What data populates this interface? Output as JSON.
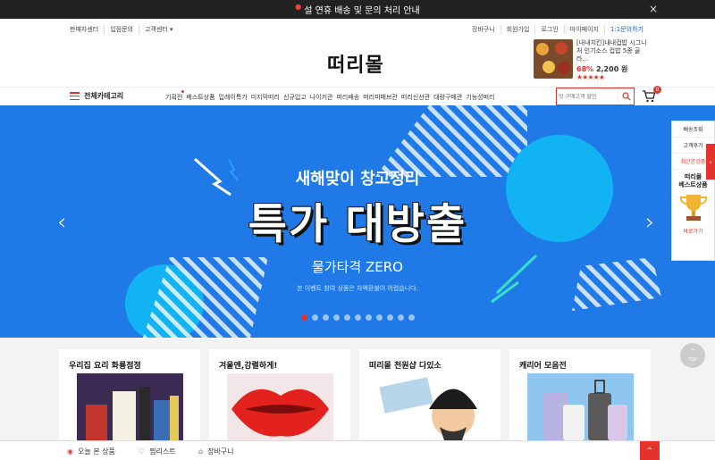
{
  "notice": {
    "text": "설 연휴 배송 및 문의 처리 안내",
    "close": "×"
  },
  "util_left": [
    "판매자센터",
    "입점문의",
    "고객센터 ▾"
  ],
  "util_right": [
    "장바구니",
    "회원가입",
    "로그인",
    "마이페이지",
    "1:1문의하기"
  ],
  "logo": "떠리몰",
  "promo": {
    "name": "[내내치킨]내내컵밥 시그니처 인기소스 컵밥 5종 골라...",
    "discount": "68%",
    "price": "2,200 원",
    "stars": "★★★★★"
  },
  "nav": {
    "category_label": "전체카테고리",
    "menu": [
      "기획전",
      "베스트상품",
      "입레이특가",
      "미지막떠리",
      "신규입고",
      "나이키관",
      "떠리배송",
      "떠리피패브관",
      "떠리신선관",
      "대량구매관",
      "기능성떠리"
    ],
    "search_placeholder": "잇 구매고객 할인",
    "cart_count": "0"
  },
  "hero": {
    "subtitle": "새해맞이 창고정리",
    "title": "특가 대방출",
    "tagline": "물가타격 ZERO",
    "note": "본 이벤트 참여 상품은 차액환불이 어렵습니다.",
    "prev": "‹",
    "next": "›",
    "slides": 11,
    "active_slide": 1
  },
  "side": {
    "items": [
      "배송조회",
      "고객후기",
      "최근본상품"
    ],
    "best_label": "떠리몰\n베스트상품",
    "more": "바로가기"
  },
  "top_button": "TOP",
  "products": [
    {
      "title": "우리집 요리 화룡점정"
    },
    {
      "title": "겨울엔,강렬하게!"
    },
    {
      "title": "떠리몰 천원샵 다있소"
    },
    {
      "title": "캐리어 모음전"
    }
  ],
  "bottombar": {
    "recent": "오늘 본 상품",
    "wishlist": "찜리스트",
    "cart": "장바구니"
  },
  "colors": {
    "accent": "#e5322d",
    "hero_bg": "#1f7ae7"
  }
}
